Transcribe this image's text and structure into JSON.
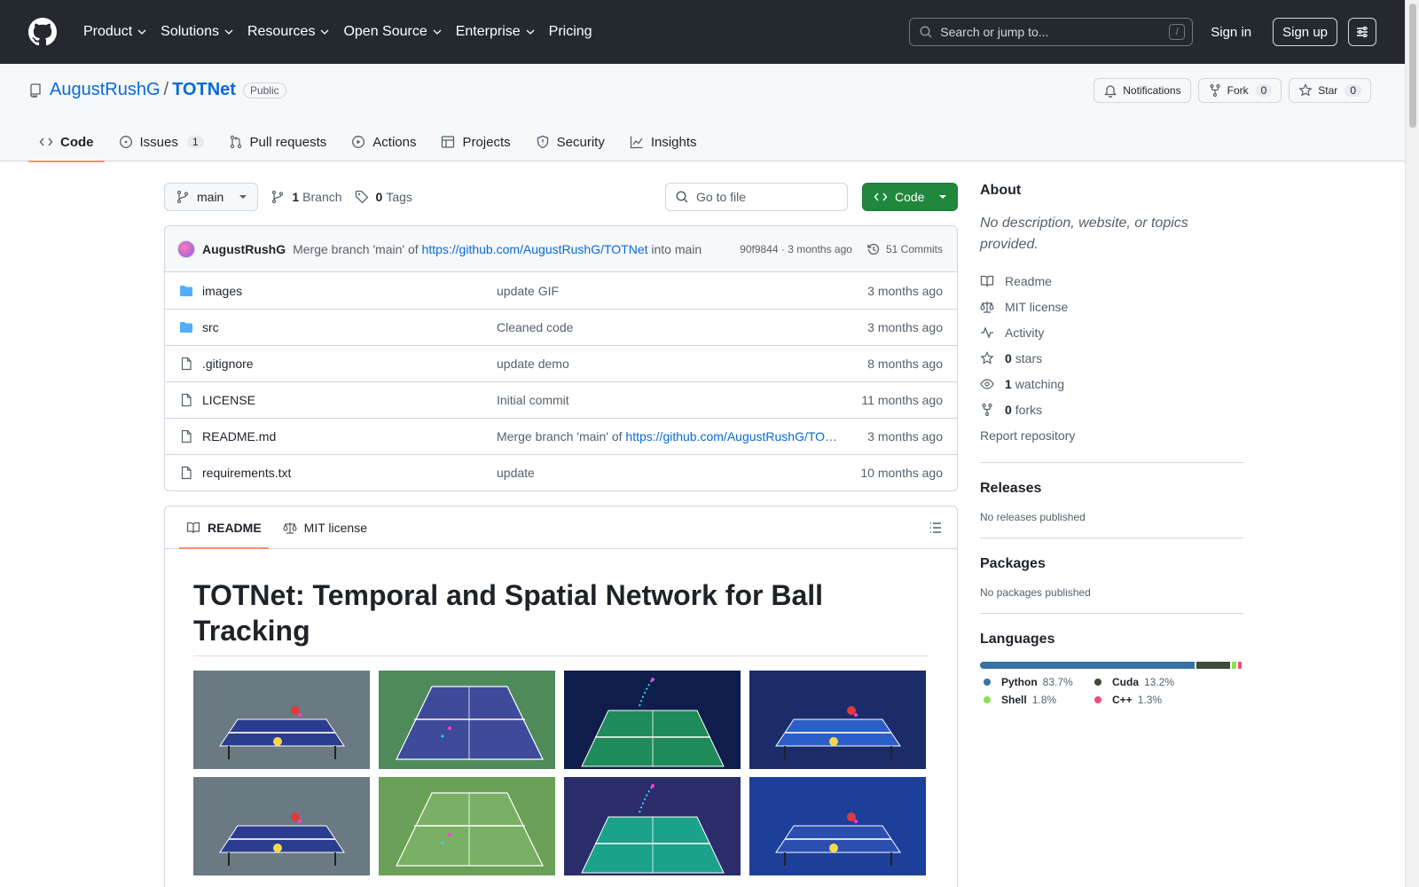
{
  "header": {
    "nav": [
      "Product",
      "Solutions",
      "Resources",
      "Open Source",
      "Enterprise",
      "Pricing"
    ],
    "search_placeholder": "Search or jump to...",
    "slash_key": "/",
    "signin": "Sign in",
    "signup": "Sign up"
  },
  "repo": {
    "owner": "AugustRushG",
    "separator": "/",
    "name": "TOTNet",
    "visibility": "Public",
    "notifications_label": "Notifications",
    "fork_label": "Fork",
    "fork_count": "0",
    "star_label": "Star",
    "star_count": "0"
  },
  "tabs": [
    {
      "label": "Code",
      "icon": "code-icon",
      "active": true
    },
    {
      "label": "Issues",
      "icon": "issue-icon",
      "count": "1"
    },
    {
      "label": "Pull requests",
      "icon": "pull-request-icon"
    },
    {
      "label": "Actions",
      "icon": "play-icon"
    },
    {
      "label": "Projects",
      "icon": "table-icon"
    },
    {
      "label": "Security",
      "icon": "shield-icon"
    },
    {
      "label": "Insights",
      "icon": "graph-icon"
    }
  ],
  "toolbar": {
    "branch": "main",
    "branch_count": "1",
    "branch_label": "Branch",
    "tag_count": "0",
    "tag_label": "Tags",
    "goto_placeholder": "Go to file",
    "code_button": "Code"
  },
  "commit": {
    "author": "AugustRushG",
    "message_prefix": "Merge branch 'main' of",
    "message_link": "https://github.com/AugustRushG/TOTNet",
    "message_suffix": "into main",
    "hash": "90f9844",
    "dot": "·",
    "time": "3 months ago",
    "commits_count": "51",
    "commits_label": "Commits"
  },
  "files": [
    {
      "type": "folder",
      "name": "images",
      "message": "update GIF",
      "date": "3 months ago"
    },
    {
      "type": "folder",
      "name": "src",
      "message": "Cleaned code",
      "date": "3 months ago"
    },
    {
      "type": "file",
      "name": ".gitignore",
      "message": "update demo",
      "date": "8 months ago"
    },
    {
      "type": "file",
      "name": "LICENSE",
      "message": "Initial commit",
      "date": "11 months ago"
    },
    {
      "type": "file",
      "name": "README.md",
      "message": "Merge branch 'main' of",
      "message_link": "https://github.com/AugustRushG/TO…",
      "date": "3 months ago"
    },
    {
      "type": "file",
      "name": "requirements.txt",
      "message": "update",
      "date": "10 months ago"
    }
  ],
  "readme": {
    "tab_readme": "README",
    "tab_license": "MIT license",
    "title": "TOTNet: Temporal and Spatial Network for Ball Tracking",
    "gifs": [
      {
        "scene": "table-tennis",
        "bg": "#6b7a82",
        "table": "#2a3d8f"
      },
      {
        "scene": "tennis",
        "bg": "#4f8a5b",
        "table": "#3e4a9a"
      },
      {
        "scene": "badminton",
        "bg": "#0f1d4a",
        "table": "#1f8a5a"
      },
      {
        "scene": "table-tennis",
        "bg": "#1c2b6a",
        "table": "#2b5fc7"
      },
      {
        "scene": "table-tennis",
        "bg": "#6b7a82",
        "table": "#2a3d8f"
      },
      {
        "scene": "tennis",
        "bg": "#6aa057",
        "table": "#7ab065"
      },
      {
        "scene": "badminton",
        "bg": "#2a2d6a",
        "table": "#1aa28a"
      },
      {
        "scene": "table-tennis",
        "bg": "#1c3f9a",
        "table": "#2b4fb0"
      }
    ]
  },
  "about": {
    "title": "About",
    "description": "No description, website, or topics provided.",
    "items": [
      {
        "icon": "book-icon",
        "label": "Readme"
      },
      {
        "icon": "law-icon",
        "label": "MIT license"
      },
      {
        "icon": "pulse-icon",
        "label": "Activity"
      },
      {
        "icon": "star-icon",
        "count": "0",
        "label": "stars"
      },
      {
        "icon": "eye-icon",
        "count": "1",
        "label": "watching"
      },
      {
        "icon": "fork-icon",
        "count": "0",
        "label": "forks"
      }
    ],
    "report": "Report repository"
  },
  "releases": {
    "title": "Releases",
    "text": "No releases published"
  },
  "packages": {
    "title": "Packages",
    "text": "No packages published"
  },
  "languages": {
    "title": "Languages",
    "list": [
      {
        "name": "Python",
        "pct": "83.7%",
        "value": 83.7,
        "color": "#3572A5"
      },
      {
        "name": "Cuda",
        "pct": "13.2%",
        "value": 13.2,
        "color": "#3A4E3A"
      },
      {
        "name": "Shell",
        "pct": "1.8%",
        "value": 1.8,
        "color": "#89e051"
      },
      {
        "name": "C++",
        "pct": "1.3%",
        "value": 1.3,
        "color": "#f34b7d"
      }
    ]
  }
}
